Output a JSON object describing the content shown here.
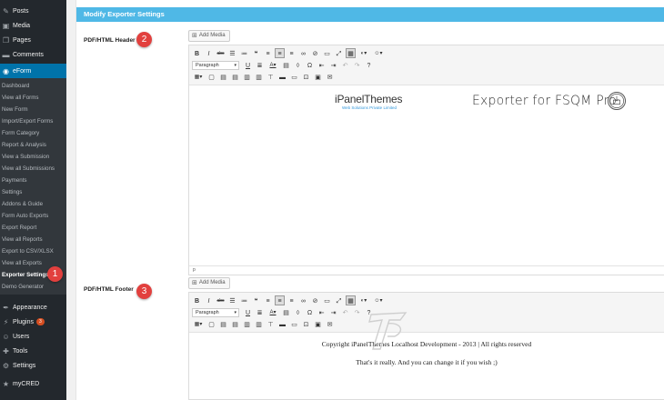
{
  "sidebar": {
    "top_items": [
      {
        "label": "Posts",
        "icon": "pin-icon"
      },
      {
        "label": "Media",
        "icon": "media-icon"
      },
      {
        "label": "Pages",
        "icon": "pages-icon"
      },
      {
        "label": "Comments",
        "icon": "comments-icon"
      }
    ],
    "active_item": {
      "label": "eForm",
      "icon": "eform-icon"
    },
    "submenu": [
      "Dashboard",
      "View all Forms",
      "New Form",
      "Import/Export Forms",
      "Form Category",
      "Report & Analysis",
      "View a Submission",
      "View all Submissions",
      "Payments",
      "Settings",
      "Addons & Guide",
      "Form Auto Exports",
      "Export Report",
      "View all Reports",
      "Export to CSV/XLSX",
      "View all Exports",
      "Exporter Settings",
      "Demo Generator"
    ],
    "bottom_items": [
      {
        "label": "Appearance",
        "icon": "appearance-icon"
      },
      {
        "label": "Plugins",
        "icon": "plugins-icon",
        "badge": "3"
      },
      {
        "label": "Users",
        "icon": "users-icon"
      },
      {
        "label": "Tools",
        "icon": "tools-icon"
      },
      {
        "label": "Settings",
        "icon": "settings-icon"
      },
      {
        "label": "myCRED",
        "icon": "mycred-icon"
      }
    ]
  },
  "markers": {
    "one": "1",
    "two": "2",
    "three": "3"
  },
  "panel": {
    "title": "Modify Exporter Settings",
    "header_label": "PDF/HTML Header",
    "footer_label": "PDF/HTML Footer",
    "add_media": "Add Media",
    "format_select": "Paragraph",
    "status_path": "p"
  },
  "header_content": {
    "logo_text": "iPanelThemes",
    "logo_tagline": "Web Solutions Private Limited",
    "title": "Exporter for FSQM Pro"
  },
  "footer_content": {
    "line1": "Copyright iPanelThemes Localhost Development - 2013 | All rights reserved",
    "line2": "That's it really. And you can change it if you wish ;)"
  },
  "colors": {
    "sidebar": "#23282d",
    "active": "#0073aa",
    "panel_header": "#4fb8e6",
    "marker": "#e2403e"
  }
}
